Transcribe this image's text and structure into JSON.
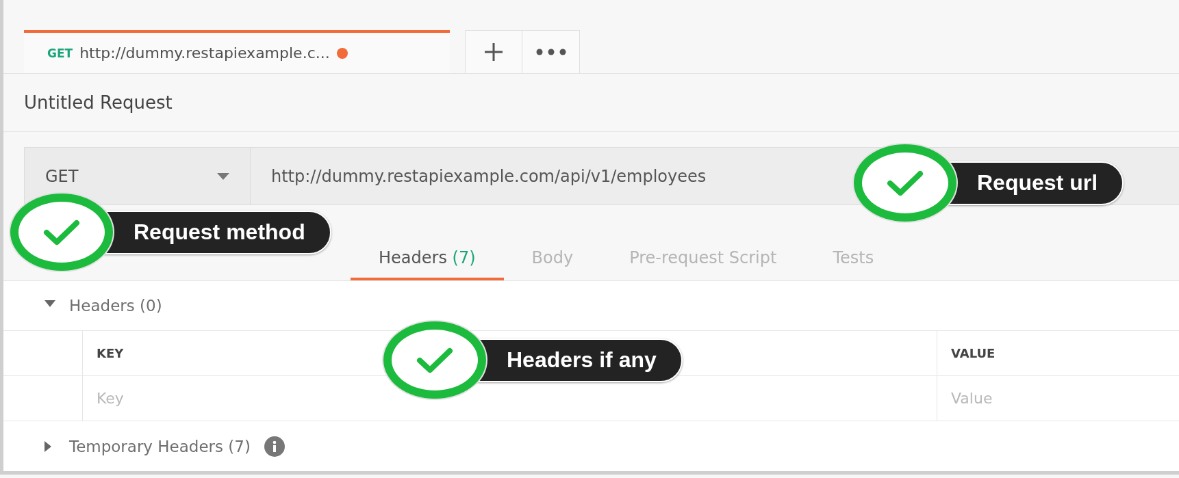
{
  "request_tabs": [
    {
      "method": "GET",
      "url": "http://dummy.restapiexample.c...",
      "unsaved": true,
      "selected": true
    }
  ],
  "title": "Untitled Request",
  "request": {
    "method": "GET",
    "url": "http://dummy.restapiexample.com/api/v1/employees"
  },
  "section_tabs": [
    {
      "label": "Headers",
      "count": "(7)",
      "selected": true
    },
    {
      "label": "Body",
      "selected": false
    },
    {
      "label": "Pre-request Script",
      "selected": false
    },
    {
      "label": "Tests",
      "selected": false
    }
  ],
  "headers_group": {
    "label": "Headers (0)",
    "expanded": true
  },
  "table": {
    "columns": [
      "KEY",
      "VALUE"
    ],
    "rows": [
      {
        "key_placeholder": "Key",
        "value_placeholder": "Value"
      }
    ]
  },
  "temporary_headers": {
    "label": "Temporary Headers (7)",
    "expanded": false
  },
  "callouts": [
    {
      "text": "Request url"
    },
    {
      "text": "Request method"
    },
    {
      "text": "Headers if any"
    }
  ]
}
